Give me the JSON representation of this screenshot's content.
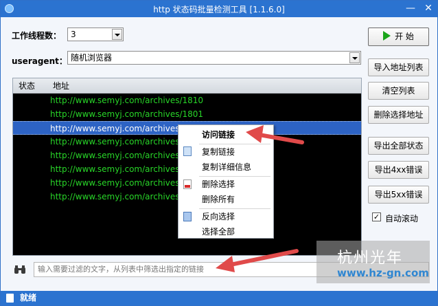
{
  "window": {
    "title": "http 状态码批量检测工具 [1.1.6.0]",
    "minimize": "—",
    "close": "✕"
  },
  "form": {
    "threads_label": "工作线程数：",
    "threads_value": "3",
    "ua_label": "useragent：",
    "ua_value": "随机浏览器"
  },
  "list": {
    "columns": [
      "状态",
      "地址"
    ],
    "rows": [
      {
        "status": "",
        "url": "http://www.semyj.com/archives/1810"
      },
      {
        "status": "",
        "url": "http://www.semyj.com/archives/1801"
      },
      {
        "status": "",
        "url": "http://www.semyj.com/archives/16",
        "selected": true
      },
      {
        "status": "",
        "url": "http://www.semyj.com/archives/16"
      },
      {
        "status": "",
        "url": "http://www.semyj.com/archives/16"
      },
      {
        "status": "",
        "url": "http://www.semyj.com/archives/15"
      },
      {
        "status": "",
        "url": "http://www.semyj.com/archives/15"
      },
      {
        "status": "",
        "url": "http://www.semyj.com/archives/14"
      }
    ]
  },
  "buttons": {
    "start": "开 始",
    "import": "导入地址列表",
    "clear": "清空列表",
    "delete_selected": "删除选择地址",
    "export_all": "导出全部状态",
    "export_4xx": "导出4xx错误",
    "export_5xx": "导出5xx错误",
    "autoscroll": "自动滚动",
    "autoscroll_checked": true
  },
  "context_menu": {
    "visit": "访问链接",
    "copy": "复制链接",
    "copy_detail": "复制详细信息",
    "delete_sel": "删除选择",
    "delete_all": "删除所有",
    "invert": "反向选择",
    "select_all": "选择全部"
  },
  "filter": {
    "placeholder": "输入需要过滤的文字，从列表中筛选出指定的链接"
  },
  "watermark": {
    "name": "杭州光年",
    "url": "www.hz-gn.com"
  },
  "status": {
    "text": "就绪"
  },
  "colors": {
    "titlebar": "#2b73d0",
    "row_text": "#28d628",
    "selection": "#2d63c4",
    "arrow": "#e04a4a"
  }
}
